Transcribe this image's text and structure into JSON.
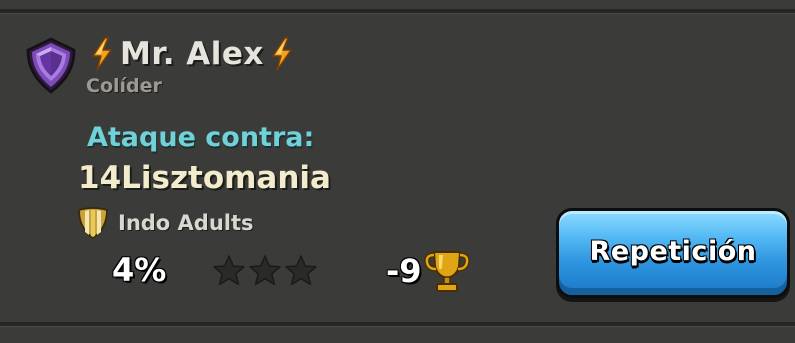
{
  "player": {
    "name": "Mr. Alex",
    "role": "Colíder",
    "league_icon": "crystal-league-shield-icon",
    "name_decoration_icon": "lightning-bolt-icon"
  },
  "attack": {
    "label": "Ataque contra:",
    "target_name": "14Lisztomania",
    "clan_name": "Indo Adults",
    "clan_icon": "clan-shield-icon",
    "destruction_percent": "4%",
    "stars_earned": 0,
    "stars_total": 3,
    "trophy_change": "-9",
    "trophy_icon": "trophy-icon"
  },
  "actions": {
    "replay_label": "Repetición"
  },
  "colors": {
    "background": "#3b3b39",
    "attack_label": "#6fd2d8",
    "target_name": "#f3eccc",
    "button_blue": "#2f96e0",
    "league_purple": "#7e4bb8",
    "trophy_gold": "#e0a514",
    "star_empty": "#2a2a29"
  }
}
